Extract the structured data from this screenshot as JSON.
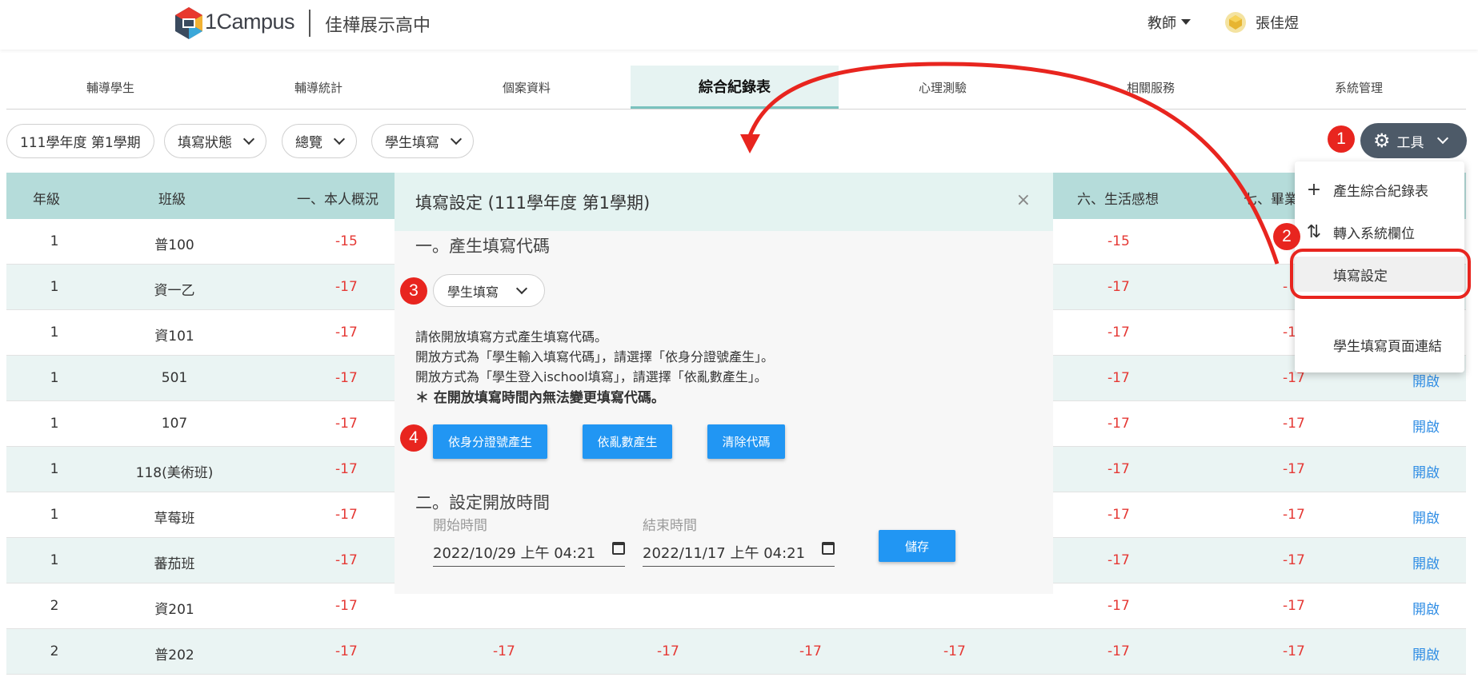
{
  "header": {
    "brand": "1Campus",
    "school": "佳樺展示高中",
    "role": "教師",
    "user": "張佳煜"
  },
  "tabs": [
    "輔導學生",
    "輔導統計",
    "個案資料",
    "綜合紀錄表",
    "心理測驗",
    "相關服務",
    "系統管理"
  ],
  "active_tab": "綜合紀錄表",
  "filters": {
    "term": "111學年度 第1學期",
    "status": "填寫狀態",
    "view": "總覽",
    "filler": "學生填寫"
  },
  "tools": {
    "label": "工具"
  },
  "table": {
    "headers": {
      "grade": "年級",
      "class": "班級",
      "col1": "一、本人概況",
      "col6": "六、生活感想",
      "col7": "七、畢業"
    },
    "rows": [
      {
        "grade": "1",
        "class": "普100",
        "c1": "-15",
        "c6": "-15",
        "c7": "",
        "open": ""
      },
      {
        "grade": "1",
        "class": "資一乙",
        "c1": "-17",
        "c6": "-17",
        "c7": "-",
        "open": ""
      },
      {
        "grade": "1",
        "class": "資101",
        "c1": "-17",
        "c6": "-17",
        "c7": "-1",
        "open": ""
      },
      {
        "grade": "1",
        "class": "501",
        "c1": "-17",
        "c6": "-17",
        "c7": "-17",
        "open": "開啟"
      },
      {
        "grade": "1",
        "class": "107",
        "c1": "-17",
        "c6": "-17",
        "c7": "-17",
        "open": "開啟"
      },
      {
        "grade": "1",
        "class": "118(美術班)",
        "c1": "-17",
        "c6": "-17",
        "c7": "-17",
        "open": "開啟"
      },
      {
        "grade": "1",
        "class": "草莓班",
        "c1": "-17",
        "c6": "-17",
        "c7": "-17",
        "open": "開啟"
      },
      {
        "grade": "1",
        "class": "蕃茄班",
        "c1": "-17",
        "c6": "-17",
        "c7": "-17",
        "open": "開啟"
      },
      {
        "grade": "2",
        "class": "資201",
        "c1": "-17",
        "c6": "-17",
        "c7": "-17",
        "open": "開啟"
      },
      {
        "grade": "2",
        "class": "普202",
        "c1": "-17",
        "c2": "-17",
        "c3": "-17",
        "c4": "-17",
        "c5": "-17",
        "c6": "-17",
        "c7": "-17",
        "open": "開啟"
      }
    ]
  },
  "menu": {
    "items": [
      {
        "label": "產生綜合紀錄表",
        "icon": "plus-icon"
      },
      {
        "label": "轉入系統欄位",
        "icon": "swap-vertical-icon"
      },
      {
        "label": "填寫設定",
        "icon": ""
      },
      {
        "label": "學生填寫頁面連結",
        "icon": ""
      }
    ]
  },
  "modal": {
    "title": "填寫設定 (111學年度 第1學期)",
    "close": "×",
    "section1": "一。產生填寫代碼",
    "mode_select": "學生填寫",
    "desc1": "請依開放填寫方式產生填寫代碼。",
    "desc2": "開放方式為「學生輸入填寫代碼」，請選擇「依身分證號產生」。",
    "desc3": "開放方式為「學生登入ischool填寫」，請選擇「依亂數產生」。",
    "desc4": "＊ 在開放填寫時間內無法變更填寫代碼。",
    "btn_id": "依身分證號產生",
    "btn_random": "依亂數產生",
    "btn_clear": "清除代碼",
    "section2": "二。設定開放時間",
    "start_label": "開始時間",
    "start_value": "2022/10/29 上午 04:21",
    "end_label": "結束時間",
    "end_value": "2022/11/17 上午 04:21",
    "save": "儲存"
  },
  "annotations": [
    "1",
    "2",
    "3",
    "4"
  ],
  "colors": {
    "accent_teal": "#b5dcda",
    "negative": "#e53935",
    "link": "#2f8de4",
    "button_blue": "#2196f3",
    "annotation_red": "#e8251f",
    "tools_button": "#4d5a68"
  }
}
